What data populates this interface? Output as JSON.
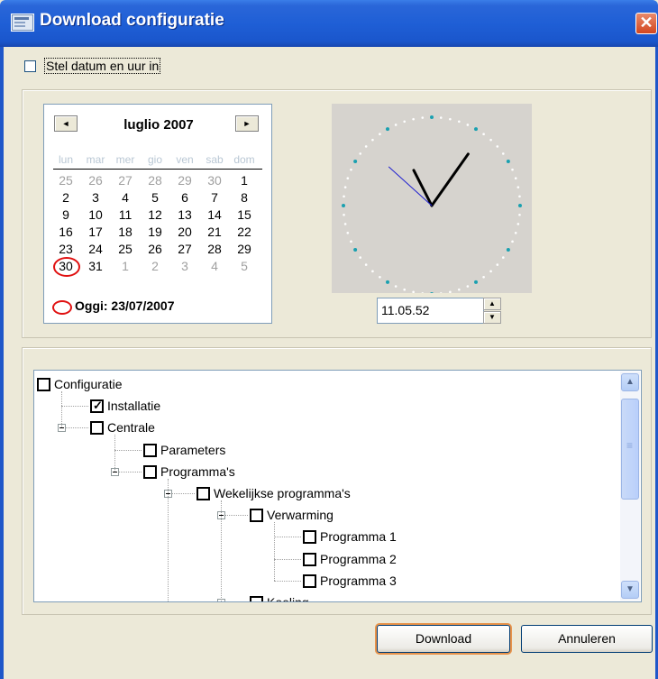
{
  "window": {
    "title": "Download configuratie",
    "close_glyph": "✕"
  },
  "set_datetime": {
    "label": "Stel datum en uur in",
    "checked": false
  },
  "calendar": {
    "month_label": "luglio 2007",
    "prev_glyph": "◄",
    "next_glyph": "►",
    "weekdays": [
      "lun",
      "mar",
      "mer",
      "gio",
      "ven",
      "sab",
      "dom"
    ],
    "weeks": [
      [
        "25",
        "26",
        "27",
        "28",
        "29",
        "30",
        "1"
      ],
      [
        "2",
        "3",
        "4",
        "5",
        "6",
        "7",
        "8"
      ],
      [
        "9",
        "10",
        "11",
        "12",
        "13",
        "14",
        "15"
      ],
      [
        "16",
        "17",
        "18",
        "19",
        "20",
        "21",
        "22"
      ],
      [
        "23",
        "24",
        "25",
        "26",
        "27",
        "28",
        "29"
      ],
      [
        "30",
        "31",
        "1",
        "2",
        "3",
        "4",
        "5"
      ]
    ],
    "muted": [
      [
        0,
        0
      ],
      [
        0,
        1
      ],
      [
        0,
        2
      ],
      [
        0,
        3
      ],
      [
        0,
        4
      ],
      [
        0,
        5
      ],
      [
        5,
        2
      ],
      [
        5,
        3
      ],
      [
        5,
        4
      ],
      [
        5,
        5
      ],
      [
        5,
        6
      ]
    ],
    "selected": "23",
    "today_label": "Oggi: 23/07/2007",
    "today_color": "#e01010"
  },
  "clock": {
    "time_value": "11.05.52",
    "hands": {
      "hour": 11.098,
      "minute": 5.87,
      "second": 52
    },
    "spin_up_glyph": "▲",
    "spin_down_glyph": "▼"
  },
  "tree": {
    "nodes": [
      {
        "label": "Configuratie",
        "checked": false,
        "level": 0,
        "expander": false
      },
      {
        "label": "Installatie",
        "checked": true,
        "level": 1,
        "expander": false
      },
      {
        "label": "Centrale",
        "checked": false,
        "level": 1,
        "expander": true
      },
      {
        "label": "Parameters",
        "checked": false,
        "level": 2,
        "expander": false
      },
      {
        "label": "Programma's",
        "checked": false,
        "level": 2,
        "expander": true
      },
      {
        "label": "Wekelijkse programma's",
        "checked": false,
        "level": 3,
        "expander": true
      },
      {
        "label": "Verwarming",
        "checked": false,
        "level": 4,
        "expander": true
      },
      {
        "label": "Programma 1",
        "checked": false,
        "level": 5,
        "expander": false
      },
      {
        "label": "Programma 2",
        "checked": false,
        "level": 5,
        "expander": false
      },
      {
        "label": "Programma 3",
        "checked": false,
        "level": 5,
        "expander": false
      },
      {
        "label": "Koeling",
        "checked": false,
        "level": 4,
        "expander": true
      }
    ],
    "scroll_up_glyph": "▲",
    "scroll_down_glyph": "▼"
  },
  "buttons": {
    "download": "Download",
    "cancel": "Annuleren"
  },
  "colors": {
    "titlebar": "#1f5fd6",
    "dialog_bg": "#ECE9D8",
    "focus_ring": "#e8934a",
    "minute_hand": "#2020d0"
  }
}
